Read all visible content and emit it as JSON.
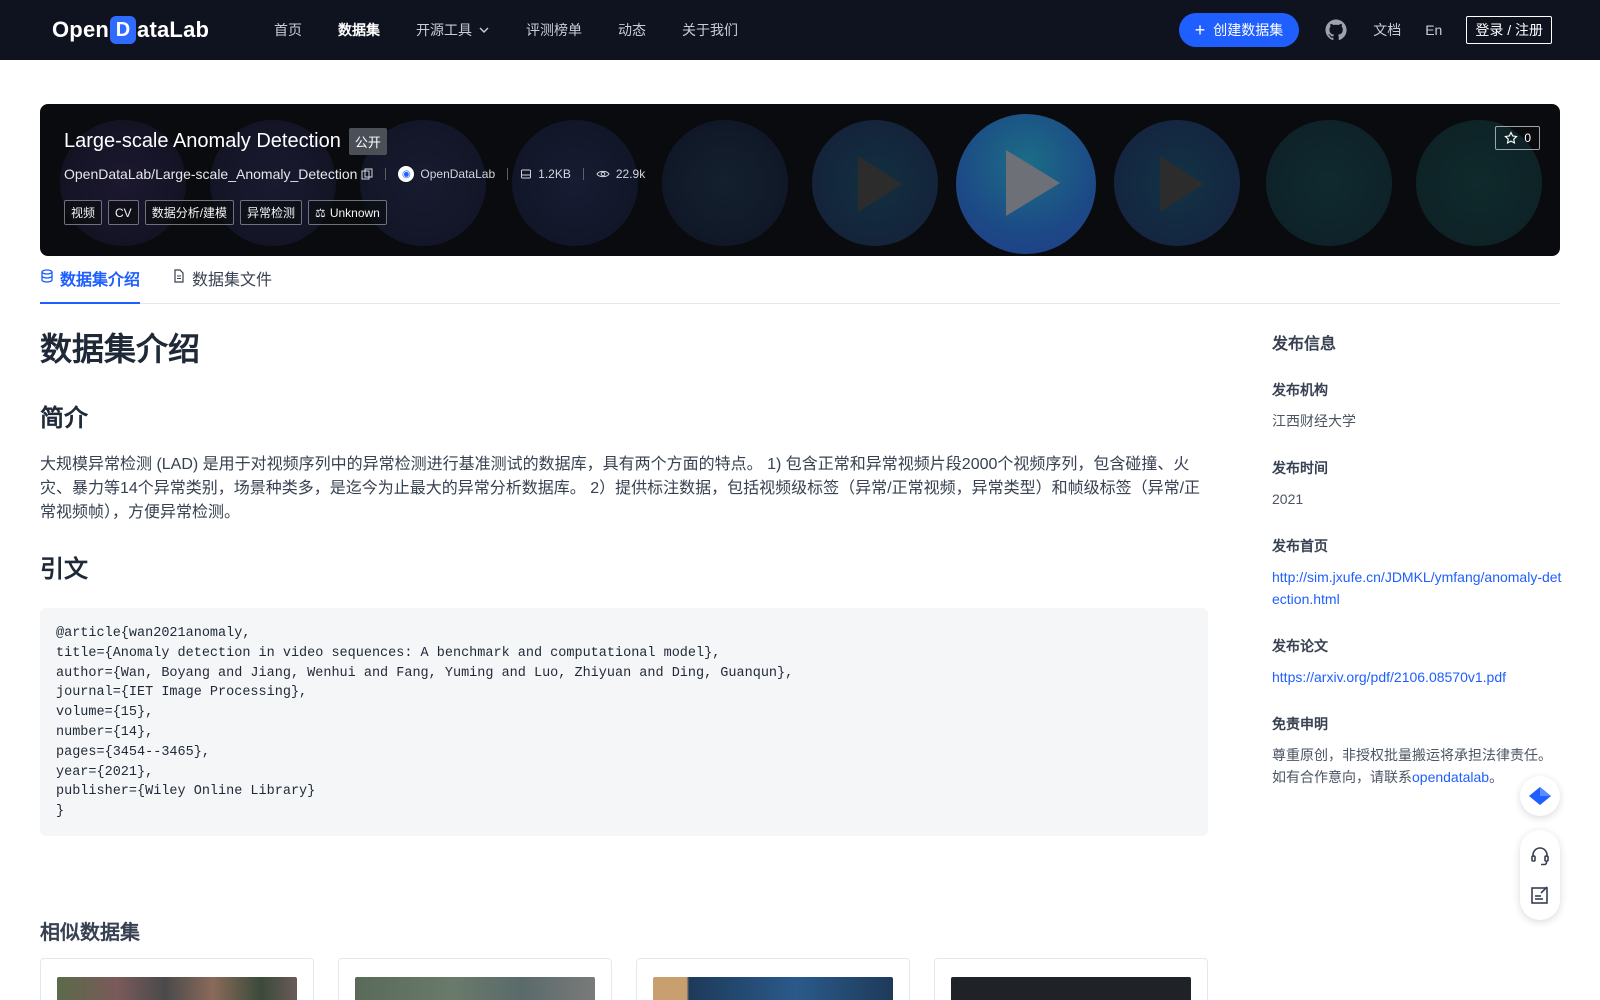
{
  "nav": {
    "logo_text_left": "Open",
    "logo_text_d": "D",
    "logo_text_right": "ataLab",
    "links": [
      {
        "label": "首页"
      },
      {
        "label": "数据集",
        "active": true
      },
      {
        "label": "开源工具",
        "has_dropdown": true
      },
      {
        "label": "评测榜单"
      },
      {
        "label": "动态"
      },
      {
        "label": "关于我们"
      }
    ],
    "create_label": "创建数据集",
    "docs_label": "文档",
    "lang_label": "En",
    "login_label": "登录 / 注册"
  },
  "hero": {
    "title": "Large-scale Anomaly Detection",
    "visibility": "公开",
    "repo_path": "OpenDataLab/Large-scale_Anomaly_Detection",
    "org_name": "OpenDataLab",
    "size": "1.2KB",
    "views": "22.9k",
    "tags": [
      "视频",
      "CV",
      "数据分析/建模",
      "异常检测"
    ],
    "license": "Unknown",
    "stars": "0"
  },
  "tabs": [
    {
      "label": "数据集介绍",
      "active": true
    },
    {
      "label": "数据集文件"
    }
  ],
  "content": {
    "heading": "数据集介绍",
    "intro_heading": "简介",
    "intro_text": "大规模异常检测 (LAD) 是用于对视频序列中的异常检测进行基准测试的数据库，具有两个方面的特点。 1) 包含正常和异常视频片段2000个视频序列，包含碰撞、火灾、暴力等14个异常类别，场景种类多，是迄今为止最大的异常分析数据库。 2）提供标注数据，包括视频级标签（异常/正常视频，异常类型）和帧级标签（异常/正常视频帧），方便异常检测。",
    "citation_heading": "引文",
    "citation": "@article{wan2021anomaly,\ntitle={Anomaly detection in video sequences: A benchmark and computational model},\nauthor={Wan, Boyang and Jiang, Wenhui and Fang, Yuming and Luo, Zhiyuan and Ding, Guanqun},\njournal={IET Image Processing},\nvolume={15},\nnumber={14},\npages={3454--3465},\nyear={2021},\npublisher={Wiley Online Library}\n}",
    "similar_heading": "相似数据集"
  },
  "sidebar": {
    "title": "发布信息",
    "publisher_label": "发布机构",
    "publisher": "江西财经大学",
    "date_label": "发布时间",
    "date": "2021",
    "homepage_label": "发布首页",
    "homepage": "http://sim.jxufe.cn/JDMKL/ymfang/anomaly-detection.html",
    "paper_label": "发布论文",
    "paper": "https://arxiv.org/pdf/2106.08570v1.pdf",
    "disclaimer_label": "免责申明",
    "disclaimer_line1": "尊重原创，非授权批量搬运将承担法律责任。",
    "disclaimer_line2_prefix": "如有合作意向，请联系",
    "disclaimer_link": "opendatalab",
    "disclaimer_suffix": "。"
  },
  "colors": {
    "accent": "#1f5eff",
    "nav_bg": "#0f1320"
  }
}
